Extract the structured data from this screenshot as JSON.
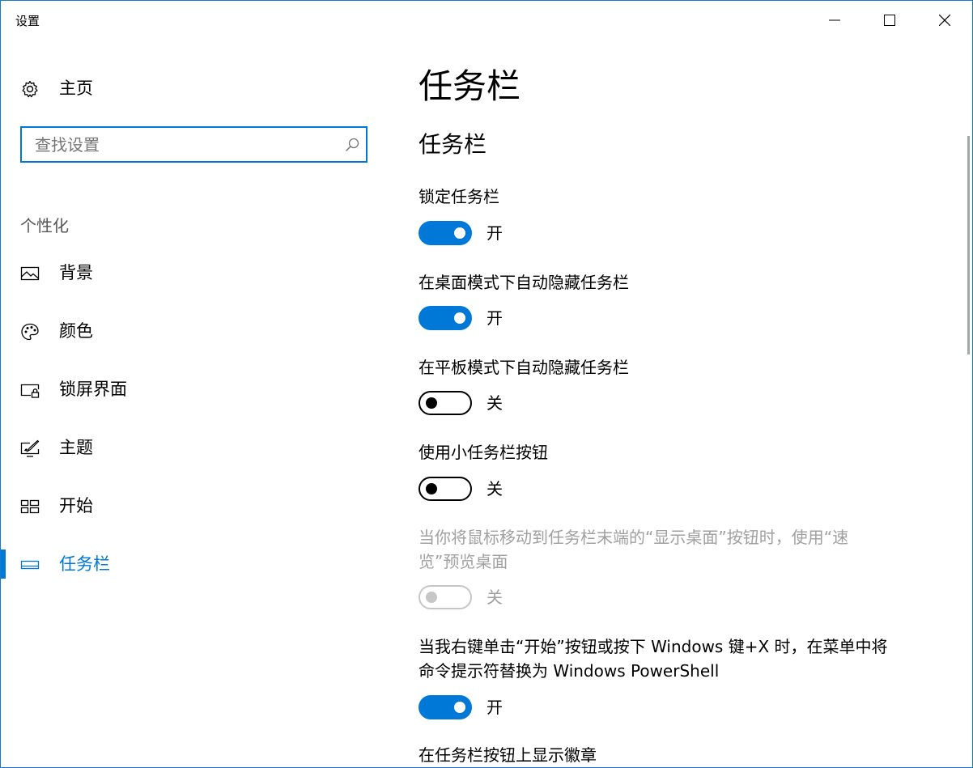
{
  "window": {
    "title": "设置"
  },
  "sidebar": {
    "home_label": "主页",
    "search_placeholder": "查找设置",
    "section_label": "个性化",
    "items": [
      {
        "label": "背景",
        "icon": "picture-icon"
      },
      {
        "label": "颜色",
        "icon": "palette-icon"
      },
      {
        "label": "锁屏界面",
        "icon": "lock-screen-icon"
      },
      {
        "label": "主题",
        "icon": "theme-brush-icon"
      },
      {
        "label": "开始",
        "icon": "start-grid-icon"
      },
      {
        "label": "任务栏",
        "icon": "taskbar-icon",
        "active": true
      }
    ]
  },
  "main": {
    "page_title": "任务栏",
    "section_title": "任务栏",
    "settings": [
      {
        "label": "锁定任务栏",
        "state": "on",
        "state_text": "开"
      },
      {
        "label": "在桌面模式下自动隐藏任务栏",
        "state": "on",
        "state_text": "开"
      },
      {
        "label": "在平板模式下自动隐藏任务栏",
        "state": "off",
        "state_text": "关"
      },
      {
        "label": "使用小任务栏按钮",
        "state": "off",
        "state_text": "关"
      },
      {
        "label_line1": "当你将鼠标移动到任务栏末端的“显示桌面”按钮时，使用“速",
        "label_line2": "览”预览桌面",
        "state": "disabled",
        "state_text": "关"
      },
      {
        "label_line1": "当我右键单击“开始”按钮或按下 Windows 键+X 时，在菜单中将",
        "label_line2": "命令提示符替换为 Windows PowerShell",
        "state": "on",
        "state_text": "开"
      },
      {
        "label": "在任务栏按钮上显示徽章"
      }
    ]
  },
  "colors": {
    "accent": "#0078d7",
    "disabled": "#a0a0a0"
  }
}
